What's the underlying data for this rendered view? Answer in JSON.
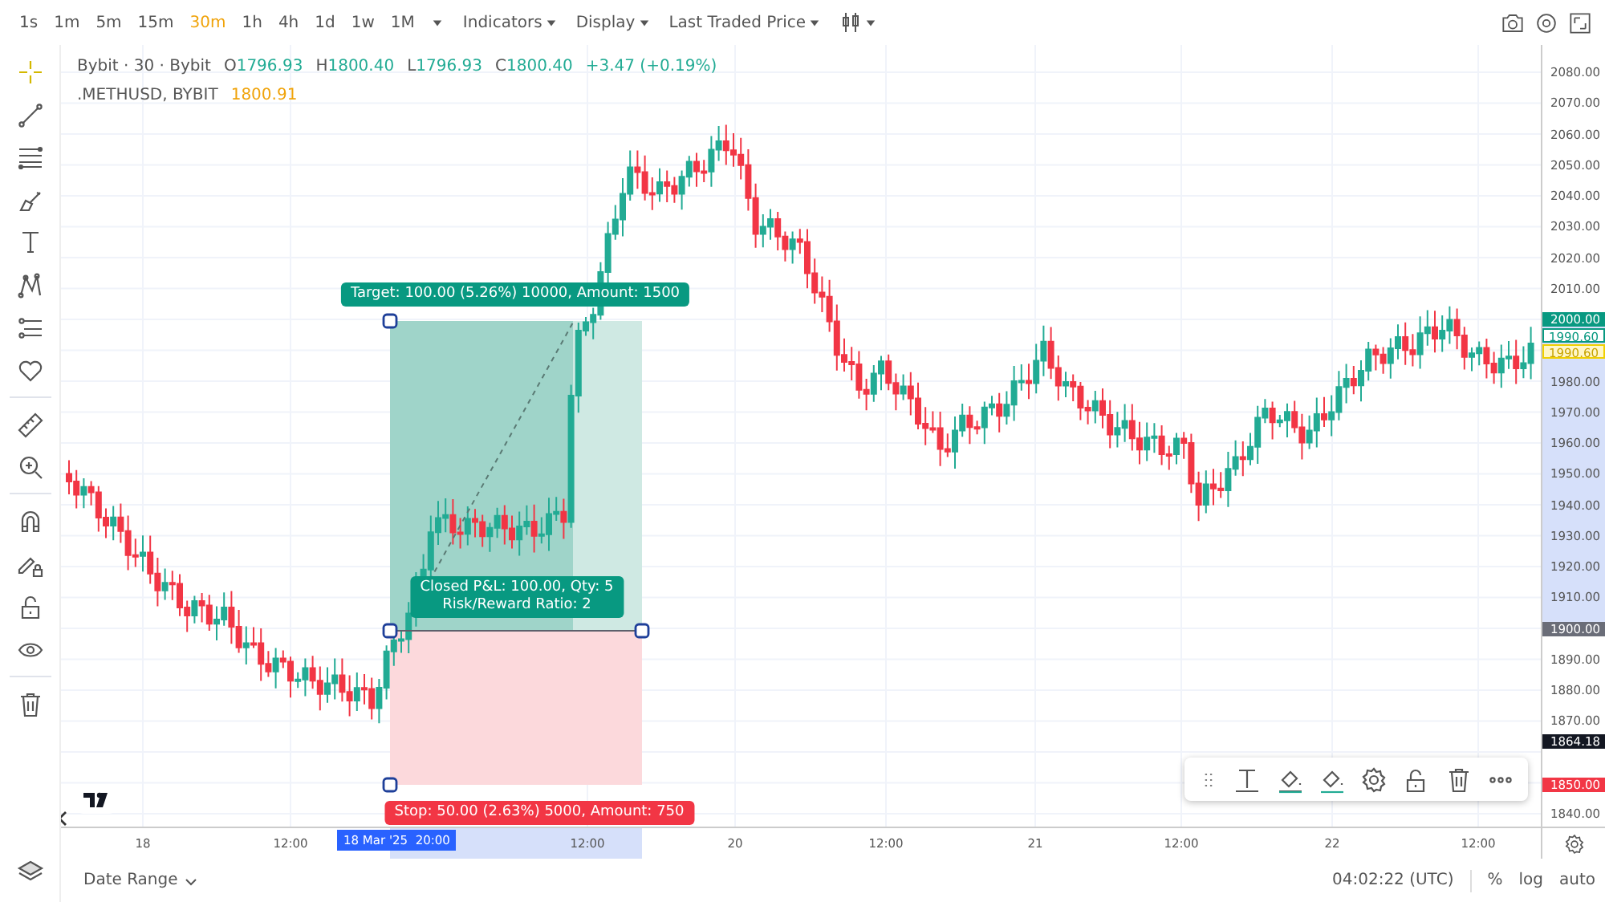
{
  "toolbar": {
    "intervals": [
      {
        "label": "1s",
        "selected": false
      },
      {
        "label": "1m",
        "selected": false
      },
      {
        "label": "5m",
        "selected": false
      },
      {
        "label": "15m",
        "selected": false
      },
      {
        "label": "30m",
        "selected": true
      },
      {
        "label": "1h",
        "selected": false
      },
      {
        "label": "4h",
        "selected": false
      },
      {
        "label": "1d",
        "selected": false
      },
      {
        "label": "1w",
        "selected": false
      },
      {
        "label": "1M",
        "selected": false
      }
    ],
    "menus": [
      "Indicators",
      "Display",
      "Last Traded Price"
    ]
  },
  "left_tools": [
    [
      {
        "kind": "crosshair",
        "selected": true
      },
      {
        "kind": "trend-line",
        "selected": false
      },
      {
        "kind": "parallel-lines",
        "selected": false
      },
      {
        "kind": "brush",
        "selected": false
      },
      {
        "kind": "text",
        "selected": false
      },
      {
        "kind": "pattern",
        "selected": false
      },
      {
        "kind": "fib",
        "selected": false
      },
      {
        "kind": "heart",
        "selected": false
      }
    ],
    [
      {
        "kind": "ruler",
        "selected": false
      },
      {
        "kind": "zoom",
        "selected": false
      }
    ],
    [
      {
        "kind": "magnet",
        "selected": false
      },
      {
        "kind": "pencil-lock",
        "selected": false
      },
      {
        "kind": "lock",
        "selected": false
      },
      {
        "kind": "eye",
        "selected": false
      }
    ],
    [
      {
        "kind": "trash",
        "selected": false
      }
    ]
  ],
  "legend": {
    "title": "Bybit · 30 · Bybit",
    "ohlc": [
      {
        "label": "O",
        "value": "1796.93"
      },
      {
        "label": "H",
        "value": "1800.40"
      },
      {
        "label": "L",
        "value": "1796.93"
      },
      {
        "label": "C",
        "value": "1800.40"
      }
    ],
    "change": "+3.47 (+0.19%)",
    "symbol": ".METHUSD, BYBIT",
    "symbol_value": "1800.91"
  },
  "position": {
    "target_label": "Target: 100.00 (5.26%) 10000, Amount: 1500",
    "pnl_lines": [
      "Closed P&L: 100.00, Qty: 5",
      "Risk/Reward Ratio: 2"
    ],
    "stop_label": "Stop: 50.00 (2.63%) 5000, Amount: 750"
  },
  "price_axis": {
    "ticks": [
      "2080.00",
      "2070.00",
      "2060.00",
      "2050.00",
      "2040.00",
      "2030.00",
      "2020.00",
      "2010.00",
      "1980.00",
      "1970.00",
      "1960.00",
      "1950.00",
      "1940.00",
      "1930.00",
      "1920.00",
      "1910.00",
      "1890.00",
      "1880.00",
      "1870.00",
      "1840.00"
    ],
    "badges": [
      {
        "kind": "target",
        "label": "2000.00"
      },
      {
        "kind": "outline",
        "label": "1990.60"
      },
      {
        "kind": "marker",
        "label": "1990.60"
      },
      {
        "kind": "entry",
        "label": "1900.00"
      },
      {
        "kind": "current",
        "label": "1864.18"
      },
      {
        "kind": "stop",
        "label": "1850.00"
      }
    ]
  },
  "time_axis": {
    "labels": [
      "18",
      "12:00",
      "12:00",
      "20",
      "12:00",
      "21",
      "12:00",
      "22",
      "12:00"
    ],
    "cursor_label": "18 Mar '25  20:00"
  },
  "bottom_bar": {
    "date_range": "Date Range",
    "clock": "04:02:22 (UTC)",
    "options": [
      "%",
      "log",
      "auto"
    ]
  }
}
